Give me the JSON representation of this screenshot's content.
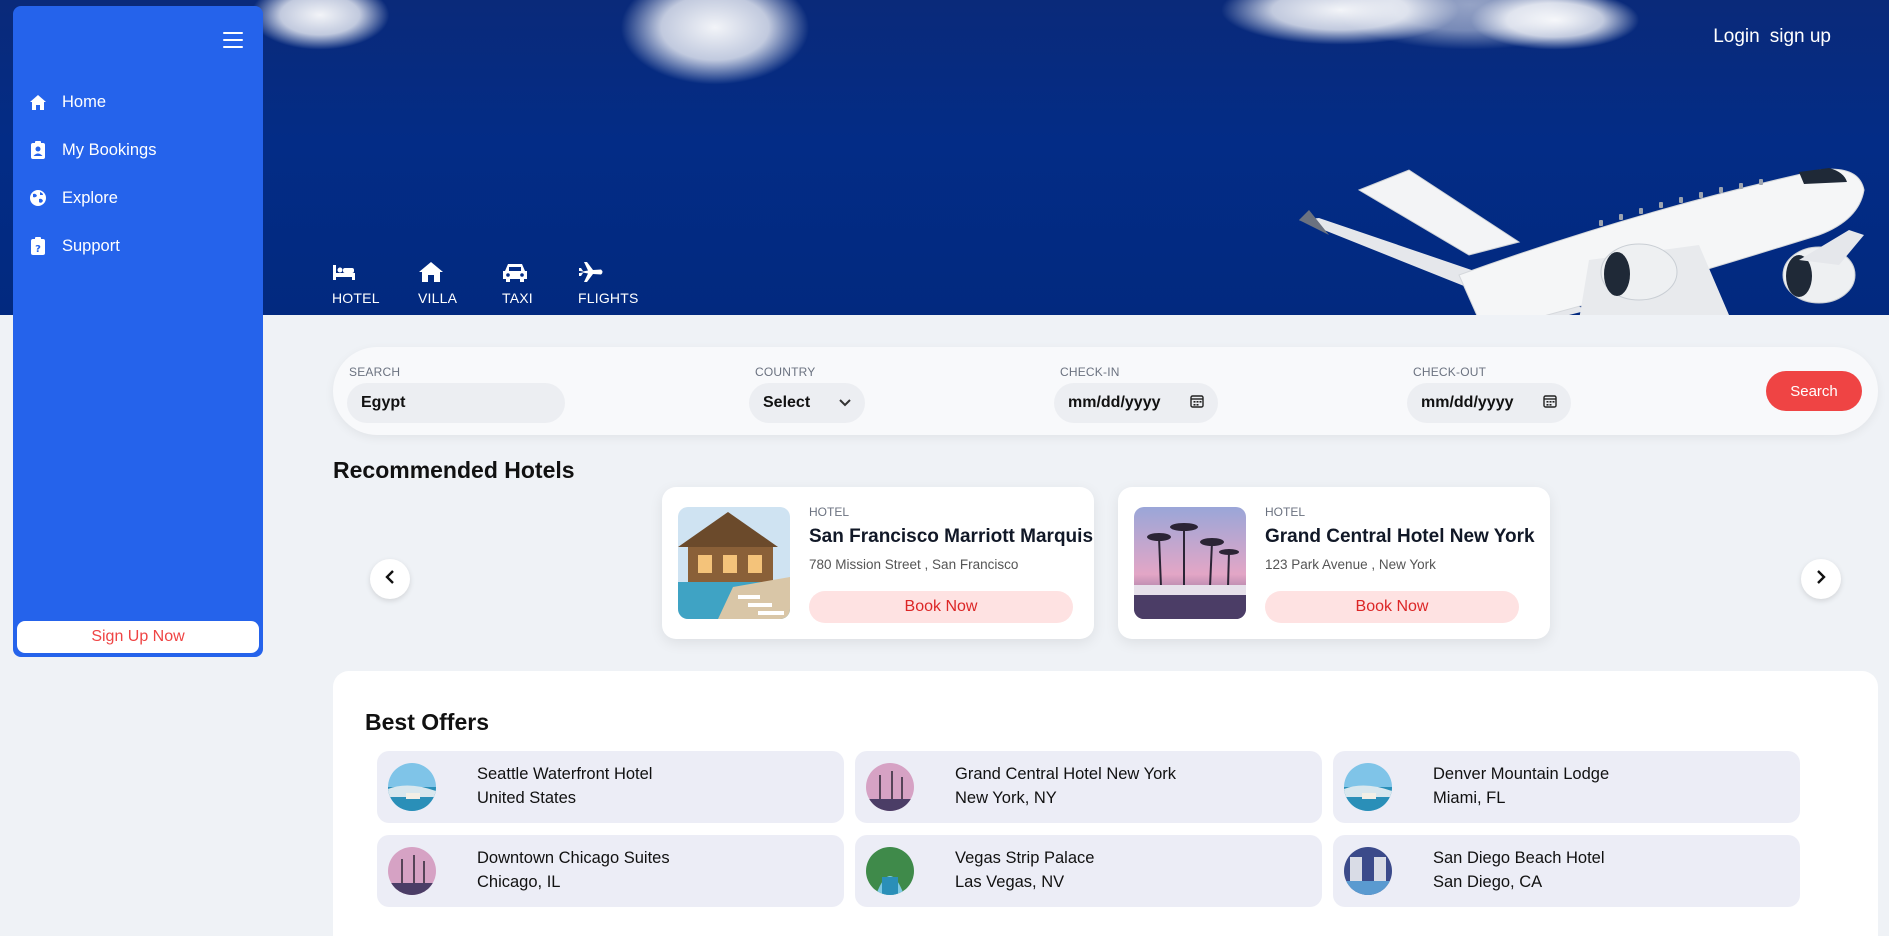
{
  "header": {
    "login_label": "Login",
    "signup_label": "sign up"
  },
  "categories": [
    {
      "label": "HOTEL",
      "icon": "bed-icon"
    },
    {
      "label": "VILLA",
      "icon": "house-icon"
    },
    {
      "label": "TAXI",
      "icon": "taxi-icon"
    },
    {
      "label": "FLIGHTS",
      "icon": "plane-icon"
    }
  ],
  "sidebar": {
    "items": [
      {
        "label": "Home",
        "icon": "home-icon"
      },
      {
        "label": "My Bookings",
        "icon": "clipboard-user-icon"
      },
      {
        "label": "Explore",
        "icon": "globe-icon"
      },
      {
        "label": "Support",
        "icon": "clipboard-question-icon"
      }
    ],
    "signup_label": "Sign Up Now"
  },
  "search": {
    "search_label": "SEARCH",
    "search_value": "Egypt",
    "country_label": "COUNTRY",
    "country_value": "Select",
    "checkin_label": "CHECK-IN",
    "checkin_placeholder": "mm/dd/yyyy",
    "checkout_label": "CHECK-OUT",
    "checkout_placeholder": "mm/dd/yyyy",
    "button_label": "Search"
  },
  "recommended": {
    "title": "Recommended Hotels",
    "hotels": [
      {
        "kind": "HOTEL",
        "name": "San Francisco Marriott Marquis",
        "address": "780 Mission Street , San Francisco",
        "button": "Book Now"
      },
      {
        "kind": "HOTEL",
        "name": "Grand Central Hotel New York",
        "address": "123 Park Avenue , New York",
        "button": "Book Now"
      }
    ]
  },
  "offers": {
    "title": "Best Offers",
    "items": [
      {
        "name": "Seattle Waterfront Hotel",
        "location": "United States"
      },
      {
        "name": "Grand Central Hotel New York",
        "location": "New York, NY"
      },
      {
        "name": "Denver Mountain Lodge",
        "location": "Miami, FL"
      },
      {
        "name": "Downtown Chicago Suites",
        "location": "Chicago, IL"
      },
      {
        "name": "Vegas Strip Palace",
        "location": "Las Vegas, NV"
      },
      {
        "name": "San Diego Beach Hotel",
        "location": "San Diego, CA"
      }
    ]
  },
  "colors": {
    "sidebar": "#2563eb",
    "accent": "#ef4444",
    "hero": "#032c86"
  }
}
